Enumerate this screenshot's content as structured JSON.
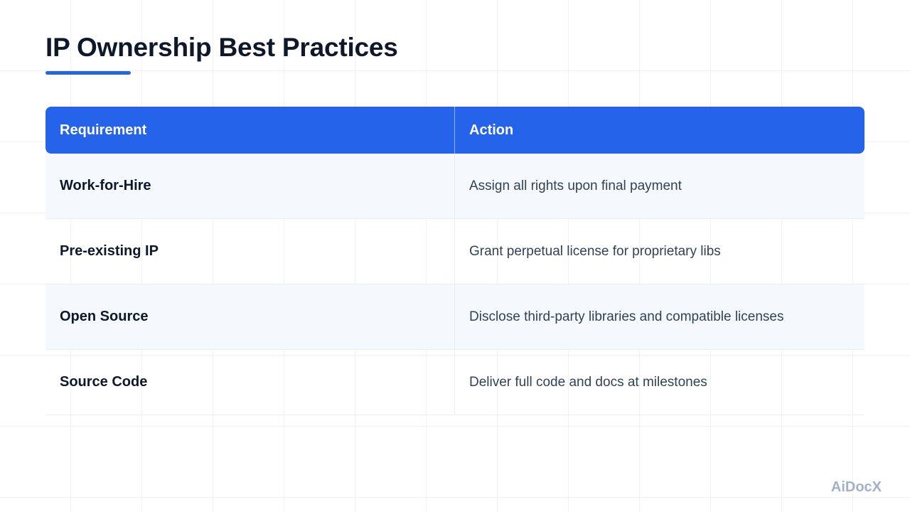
{
  "slide": {
    "title": "IP Ownership Best Practices",
    "brand": "AiDocX"
  },
  "table": {
    "headers": {
      "requirement": "Requirement",
      "action": "Action"
    },
    "rows": [
      {
        "requirement": "Work-for-Hire",
        "action": "Assign all rights upon final payment"
      },
      {
        "requirement": "Pre-existing IP",
        "action": "Grant perpetual license for proprietary libs"
      },
      {
        "requirement": "Open Source",
        "action": "Disclose third-party libraries and compatible licenses"
      },
      {
        "requirement": "Source Code",
        "action": "Deliver full code and docs at milestones"
      }
    ]
  },
  "colors": {
    "accent": "#2563eb",
    "title": "#0f172a",
    "row_alt": "#f5f9fe",
    "brand": "#a3b1c6"
  }
}
